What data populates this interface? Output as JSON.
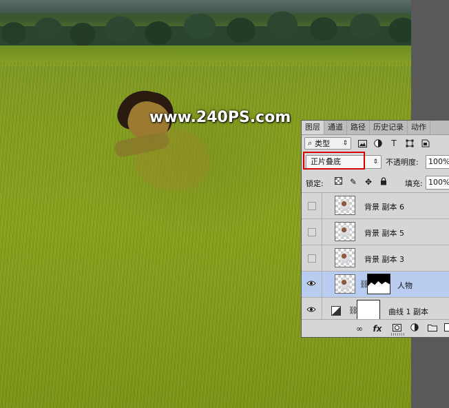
{
  "watermark": "www.240PS.com",
  "layers_panel": {
    "tabs": [
      {
        "label": "图层",
        "active": true
      },
      {
        "label": "通道",
        "active": false
      },
      {
        "label": "路径",
        "active": false
      },
      {
        "label": "历史记录",
        "active": false
      },
      {
        "label": "动作",
        "active": false
      }
    ],
    "filter": {
      "search_icon": "magnifier-icon",
      "type_label": "类型",
      "icons": [
        "image-filter-icon",
        "adjustment-filter-icon",
        "type-filter-icon",
        "shape-filter-icon",
        "smart-object-filter-icon"
      ]
    },
    "blend_mode": "正片叠底",
    "opacity_label": "不透明度:",
    "opacity_value": "100%",
    "lock_label": "锁定:",
    "lock_icons": [
      "lock-transparent-icon",
      "lock-image-icon",
      "lock-position-icon",
      "lock-all-icon"
    ],
    "fill_label": "填充:",
    "fill_value": "100%",
    "layers": [
      {
        "name": "背景 副本 6",
        "visible": false,
        "selected": false,
        "has_mask": false
      },
      {
        "name": "背景 副本 5",
        "visible": false,
        "selected": false,
        "has_mask": false
      },
      {
        "name": "背景 副本 3",
        "visible": false,
        "selected": false,
        "has_mask": false
      },
      {
        "name": "人物",
        "visible": true,
        "selected": true,
        "has_mask": true
      },
      {
        "name": "曲线 1 副本",
        "visible": true,
        "selected": false,
        "has_mask": true,
        "adjustment": true
      }
    ],
    "bottom_icons": [
      "link-layers-icon",
      "fx-icon",
      "add-mask-icon",
      "new-adjustment-icon",
      "new-group-icon",
      "new-layer-icon"
    ],
    "fx_label": "fx"
  },
  "colors": {
    "highlight_border": "#d40000",
    "selected_layer": "#b9cdf0",
    "panel_bg": "#d6d6d6"
  }
}
